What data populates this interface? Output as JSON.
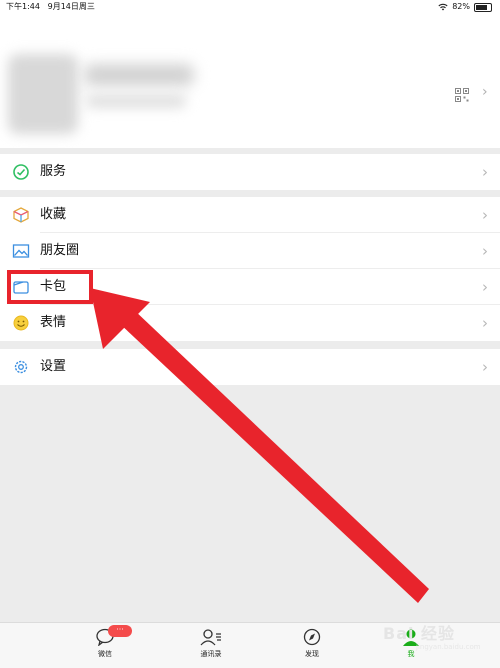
{
  "status_bar": {
    "time": "下午1:44",
    "date": "9月14日周三",
    "battery": "82%",
    "battery_fraction": 0.82
  },
  "profile": {
    "qr_icon": "qr-code-icon"
  },
  "menu": [
    {
      "key": "services",
      "label": "服务",
      "icon": "service-check-icon"
    },
    {
      "key": "favorites",
      "label": "收藏",
      "icon": "cube-icon"
    },
    {
      "key": "moments",
      "label": "朋友圈",
      "icon": "image-icon"
    },
    {
      "key": "cards",
      "label": "卡包",
      "icon": "card-wallet-icon"
    },
    {
      "key": "stickers",
      "label": "表情",
      "icon": "smiley-icon"
    },
    {
      "key": "settings",
      "label": "设置",
      "icon": "gear-icon"
    }
  ],
  "tabbar": {
    "chats": "微信",
    "contacts": "通讯录",
    "discover": "发现",
    "me": "我",
    "badge": "···"
  },
  "watermark": {
    "main": "Bai 经验",
    "sub": "jingyan.baidu.com"
  },
  "colors": {
    "highlight": "#e8242c",
    "active_tab": "#1aad19",
    "badge": "#f44b4b"
  }
}
